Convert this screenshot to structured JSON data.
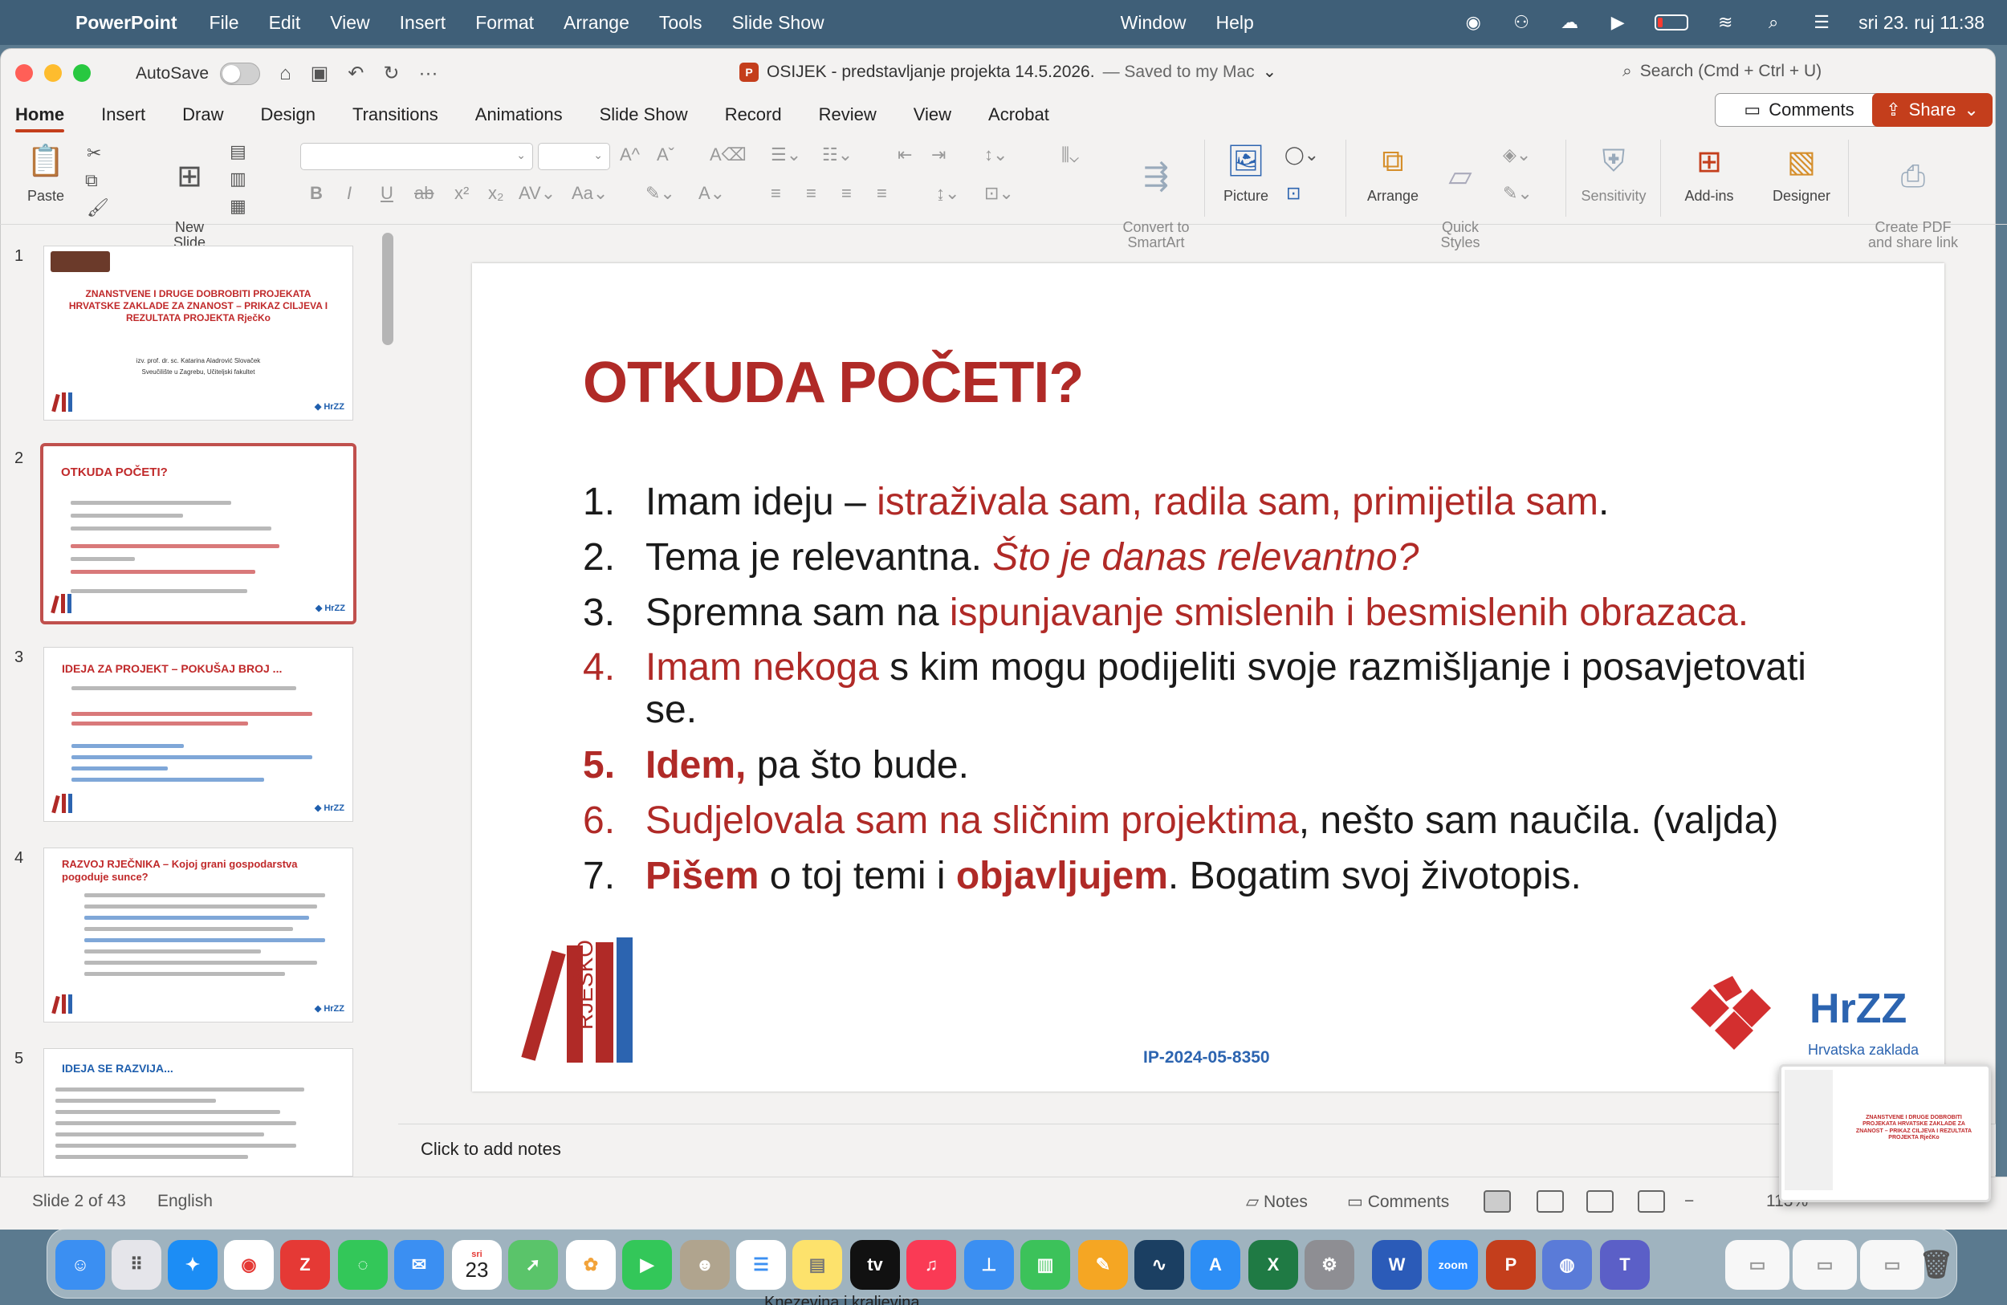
{
  "menubar": {
    "app": "PowerPoint",
    "items": [
      "File",
      "Edit",
      "View",
      "Insert",
      "Format",
      "Arrange",
      "Tools",
      "Slide Show"
    ],
    "right_items": [
      "Window",
      "Help"
    ],
    "clock": "sri 23. ruj  11:38"
  },
  "window": {
    "autosave_label": "AutoSave",
    "doc_title": "OSIJEK - predstavljanje projekta 14.5.2026.",
    "saved_status": "— Saved to my Mac",
    "search_placeholder": "Search (Cmd + Ctrl + U)"
  },
  "ribbon": {
    "tabs": [
      "Home",
      "Insert",
      "Draw",
      "Design",
      "Transitions",
      "Animations",
      "Slide Show",
      "Record",
      "Review",
      "View",
      "Acrobat"
    ],
    "active_tab": "Home",
    "comments_label": "Comments",
    "share_label": "Share",
    "paste": "Paste",
    "new_slide": "New\nSlide",
    "convert_smartart": "Convert to\nSmartArt",
    "picture": "Picture",
    "arrange": "Arrange",
    "quick_styles": "Quick\nStyles",
    "sensitivity": "Sensitivity",
    "addins": "Add-ins",
    "designer": "Designer",
    "create_pdf": "Create PDF\nand share link"
  },
  "thumbnails": [
    {
      "num": "1",
      "title": "ZNANSTVENE I DRUGE DOBROBITI PROJEKATA HRVATSKE ZAKLADE ZA ZNANOST – PRIKAZ CILJEVA I REZULTATA PROJEKTA RječKo",
      "subtitle": "izv. prof. dr. sc. Katarina Aladrović Slovaček",
      "subtitle2": "Sveučilište u Zagrebu, Učiteljski fakultet"
    },
    {
      "num": "2",
      "title": "OTKUDA POČETI?"
    },
    {
      "num": "3",
      "title": "IDEJA ZA PROJEKT – POKUŠAJ BROJ ..."
    },
    {
      "num": "4",
      "title": "RAZVOJ RJEČNIKA – Kojoj grani gospodarstva pogoduje sunce?"
    },
    {
      "num": "5",
      "title": "IDEJA SE RAZVIJA..."
    }
  ],
  "slide": {
    "title": "OTKUDA POČETI?",
    "items": [
      {
        "num": "1.",
        "a": "Imam ideju – ",
        "b": "istraživala sam, radila sam, primijetila sam",
        "c": "."
      },
      {
        "num": "2.",
        "a": "Tema je relevantna. ",
        "b": "Što je danas relevantno?"
      },
      {
        "num": "3.",
        "a": "Spremna sam na ",
        "b": "ispunjavanje smislenih i besmislenih obrazaca."
      },
      {
        "num": "4.",
        "a": "Imam nekoga",
        "b": " s kim mogu podijeliti svoje razmišljanje i posavjetovati se."
      },
      {
        "num": "5.",
        "a": "Idem,",
        "b": " pa što bude."
      },
      {
        "num": "6.",
        "a": "Sudjelovala sam na sličnim projektima",
        "b": ", nešto sam naučila. (valjda)"
      },
      {
        "num": "7.",
        "a": "Pišem",
        "b": " o toj temi i ",
        "c": "objavljujem",
        "d": ". Bogatim svoj životopis."
      }
    ],
    "project_code": "IP-2024-05-8350",
    "logo_left_text": "RJEŠKO",
    "logo_right_text": "HrZZ",
    "logo_right_sub": "Hrvatska zaklada"
  },
  "notes_placeholder": "Click to add notes",
  "statusbar": {
    "slide_info": "Slide 2 of 43",
    "language": "English",
    "notes": "Notes",
    "comments": "Comments",
    "zoom": "113%"
  },
  "dock": {
    "calendar_month": "sri",
    "calendar_day": "23",
    "tv_label": "tv",
    "zoom_label": "zoom"
  },
  "bottom_text": "Knezevina i kraljevina",
  "colors": {
    "accent": "#c43e1c",
    "slide_red": "#b02a27",
    "slide_blue": "#2c64b0"
  }
}
